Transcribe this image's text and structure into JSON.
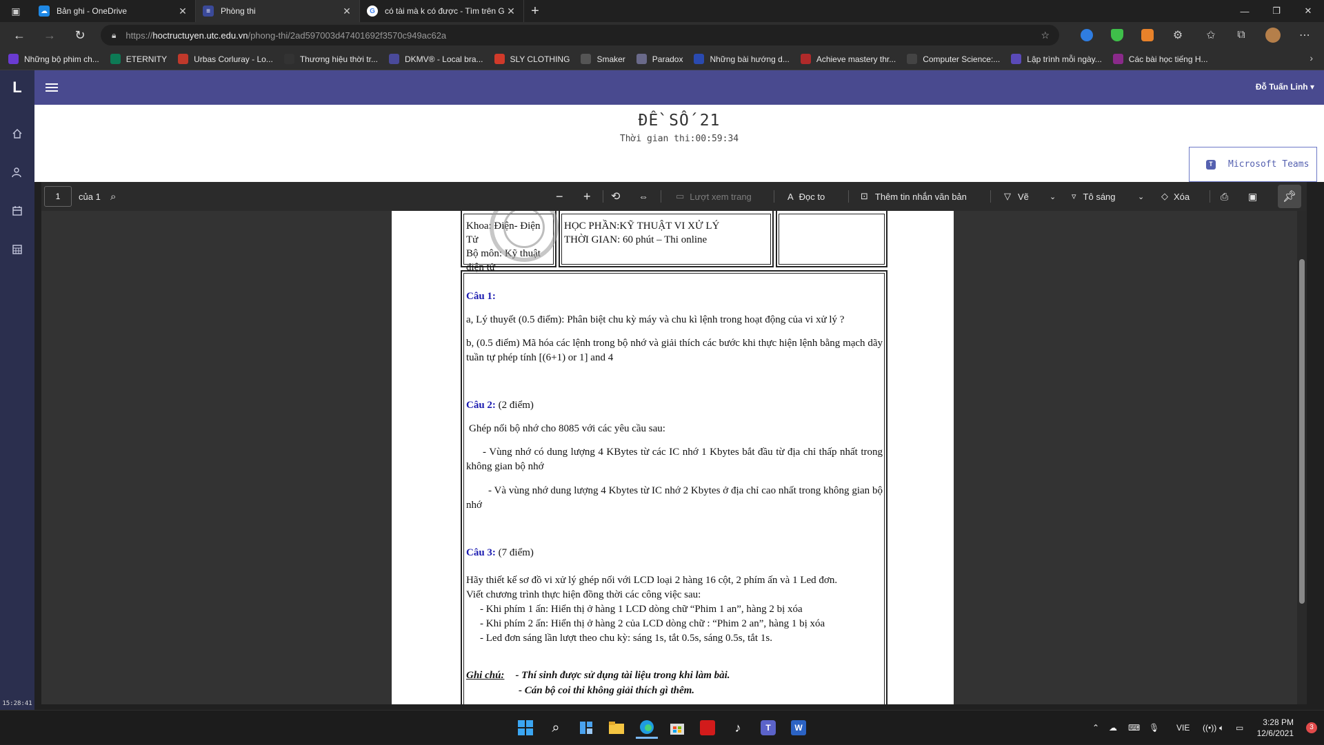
{
  "browser": {
    "tabs": [
      {
        "title": "Bản ghi - OneDrive",
        "active": false
      },
      {
        "title": "Phòng thi",
        "active": true
      },
      {
        "title": "có tài mà k có được - Tìm trên G",
        "active": false
      }
    ],
    "url_prefix": "https://",
    "url_host": "hoctructuyen.utc.edu.vn",
    "url_path": "/phong-thi/2ad597003d47401692f3570c949ac62a",
    "bookmarks": [
      {
        "label": "Những bộ phim ch...",
        "color": "#6a3bd1"
      },
      {
        "label": "ETERNITY",
        "color": "#0d7a55"
      },
      {
        "label": "Urbas Corluray - Lo...",
        "color": "#c0392b"
      },
      {
        "label": "Thương hiệu thời tr...",
        "color": "#333333"
      },
      {
        "label": "DKMV® - Local bra...",
        "color": "#4a4a9a"
      },
      {
        "label": "SLY CLOTHING",
        "color": "#d03a2a"
      },
      {
        "label": "Smaker",
        "color": "#555555"
      },
      {
        "label": "Paradox",
        "color": "#6a6a8a"
      },
      {
        "label": "Những bài hướng d...",
        "color": "#2a4ab0"
      },
      {
        "label": "Achieve mastery thr...",
        "color": "#b02a2a"
      },
      {
        "label": "Computer Science:...",
        "color": "#444444"
      },
      {
        "label": "Lập trình mỗi ngày...",
        "color": "#5a4ab8"
      },
      {
        "label": "Các bài học tiếng H...",
        "color": "#8a2a8a"
      }
    ]
  },
  "site": {
    "logo": "L",
    "clock": "15:28:41",
    "user": "Đỗ Tuấn Linh",
    "exam_title": "ĐỀ SỐ 21",
    "exam_time": "Thời gian thi:00:59:34",
    "teams_button": "Microsoft Teams"
  },
  "pdf": {
    "page": "1",
    "of": "của 1",
    "toolbar": {
      "page_view": "Lượt xem trang",
      "read_aloud": "Đọc to",
      "add_text": "Thêm tin nhắn văn bản",
      "draw": "Vẽ",
      "highlight": "Tô sáng",
      "erase": "Xóa"
    },
    "header": {
      "faculty": "Khoa: Điện- Điện Tử",
      "dept": "Bộ môn: Kỹ thuật điện tử",
      "course": "HỌC PHẦN:KỸ THUẬT VI XỬ LÝ",
      "time": "THỜI GIAN: 60 phút – Thi online"
    },
    "q1_label": "Câu 1:",
    "q1_a": "a, Lý thuyết (0.5 điểm): Phân biệt chu kỳ máy và chu kì lệnh trong hoạt động của vi xử lý ?",
    "q1_b": "b, (0.5 điểm) Mã hóa các lệnh trong bộ nhớ và giải thích các bước khi thực hiện lệnh bằng mạch dãy tuần tự phép tính [(6+1) or 1] and 4",
    "q2_label": "Câu 2:",
    "q2_points": " (2 điểm)",
    "q2_intro": "Ghép nối bộ nhớ cho 8085 với các yêu cầu sau:",
    "q2_a": "- Vùng nhớ có dung lượng 4 KBytes từ các IC nhớ 1 Kbytes bắt đầu từ địa chỉ thấp nhất trong không gian bộ nhớ",
    "q2_b": "- Và vùng nhớ dung lượng 4 Kbytes từ IC nhớ 2 Kbytes ở địa chỉ cao nhất trong không gian bộ nhớ",
    "q3_label": "Câu 3:",
    "q3_points": " (7 điểm)",
    "q3_l1": "Hãy thiết kế sơ đồ vi xử lý ghép nối với LCD loại 2 hàng 16 cột, 2 phím ấn và 1 Led đơn.",
    "q3_l2": "Viết chương trình thực hiện đồng thời các công việc sau:",
    "q3_l3": "- Khi phím 1 ấn: Hiển thị ở hàng 1 LCD dòng chữ “Phim 1 an”, hàng 2 bị xóa",
    "q3_l4": "- Khi phím 2 ấn: Hiển thị ở hàng 2 của LCD dòng chữ : “Phim 2 an”, hàng 1 bị xóa",
    "q3_l5": "- Led đơn sáng lần lượt theo chu kỳ: sáng 1s, tắt 0.5s, sáng 0.5s, tắt 1s.",
    "note_label": "Ghi chú:",
    "note_1": "- Thí sinh được sử dụng tài liệu trong khi làm bài.",
    "note_2": "- Cán bộ coi thi không giải thích gì thêm."
  },
  "taskbar": {
    "lang": "VIE",
    "time": "3:28 PM",
    "date": "12/6/2021",
    "notifications": "3"
  }
}
